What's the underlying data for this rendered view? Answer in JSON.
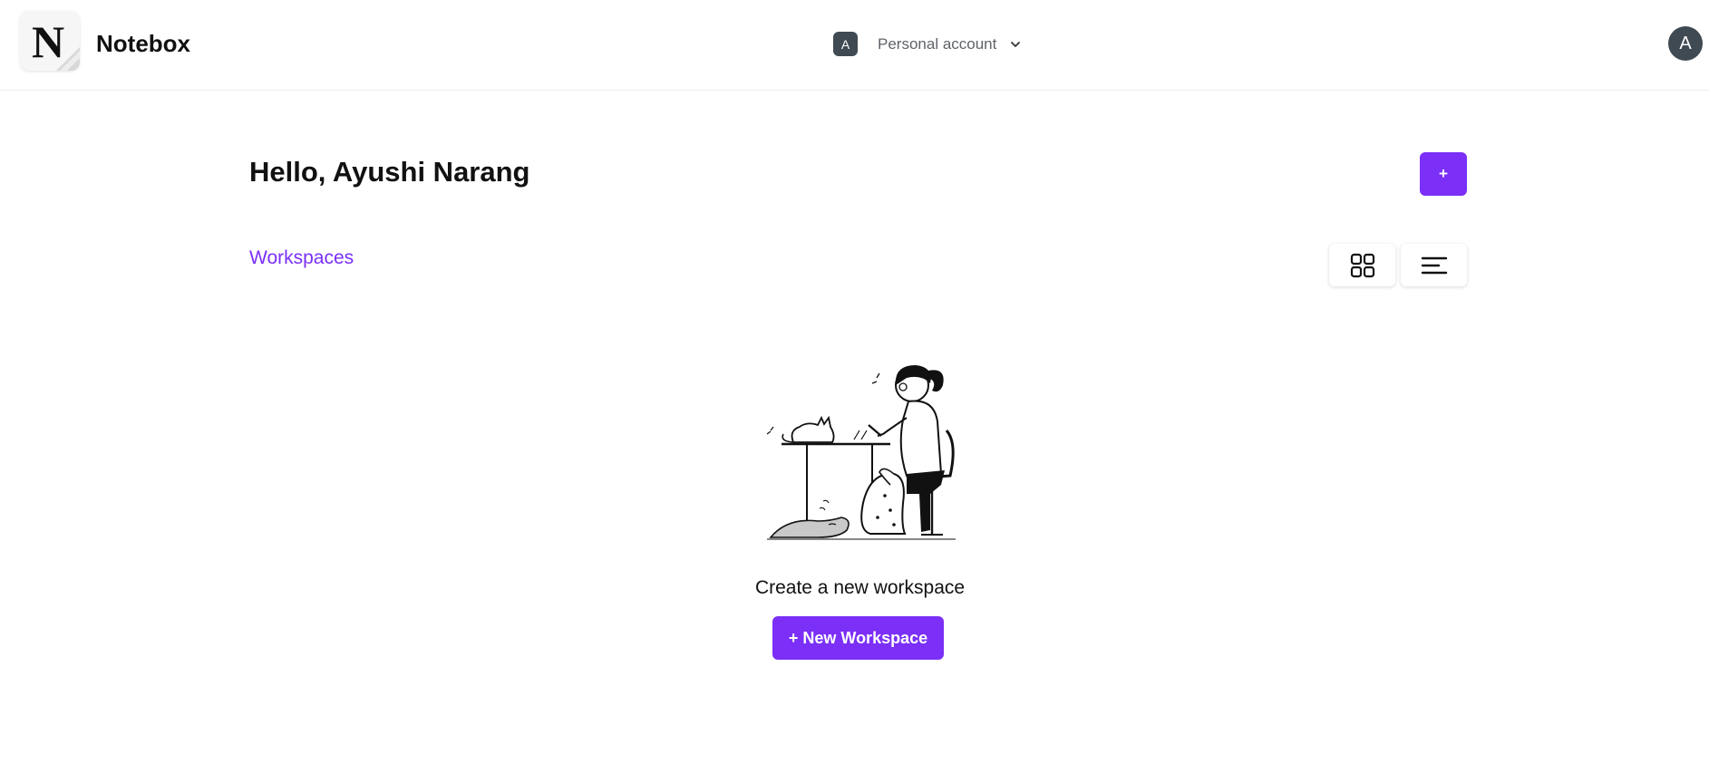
{
  "header": {
    "brand": "Notebox",
    "logo_letter": "N",
    "account": {
      "badge_letter": "A",
      "name": "Personal account"
    },
    "user_avatar_letter": "A"
  },
  "main": {
    "greeting": "Hello, Ayushi Narang",
    "add_button_label": "+",
    "section_title": "Workspaces",
    "view_toggles": [
      {
        "name": "grid-view",
        "icon": "grid-icon"
      },
      {
        "name": "list-view",
        "icon": "list-icon"
      }
    ],
    "empty_state": {
      "illustration": "woman-at-desk-with-pets-illustration",
      "message": "Create a new workspace",
      "button_label": "+ New Workspace"
    }
  },
  "colors": {
    "accent": "#7b2ff7",
    "avatar_bg": "#3f4a53",
    "text": "#111111",
    "muted_text": "#5f6368"
  }
}
